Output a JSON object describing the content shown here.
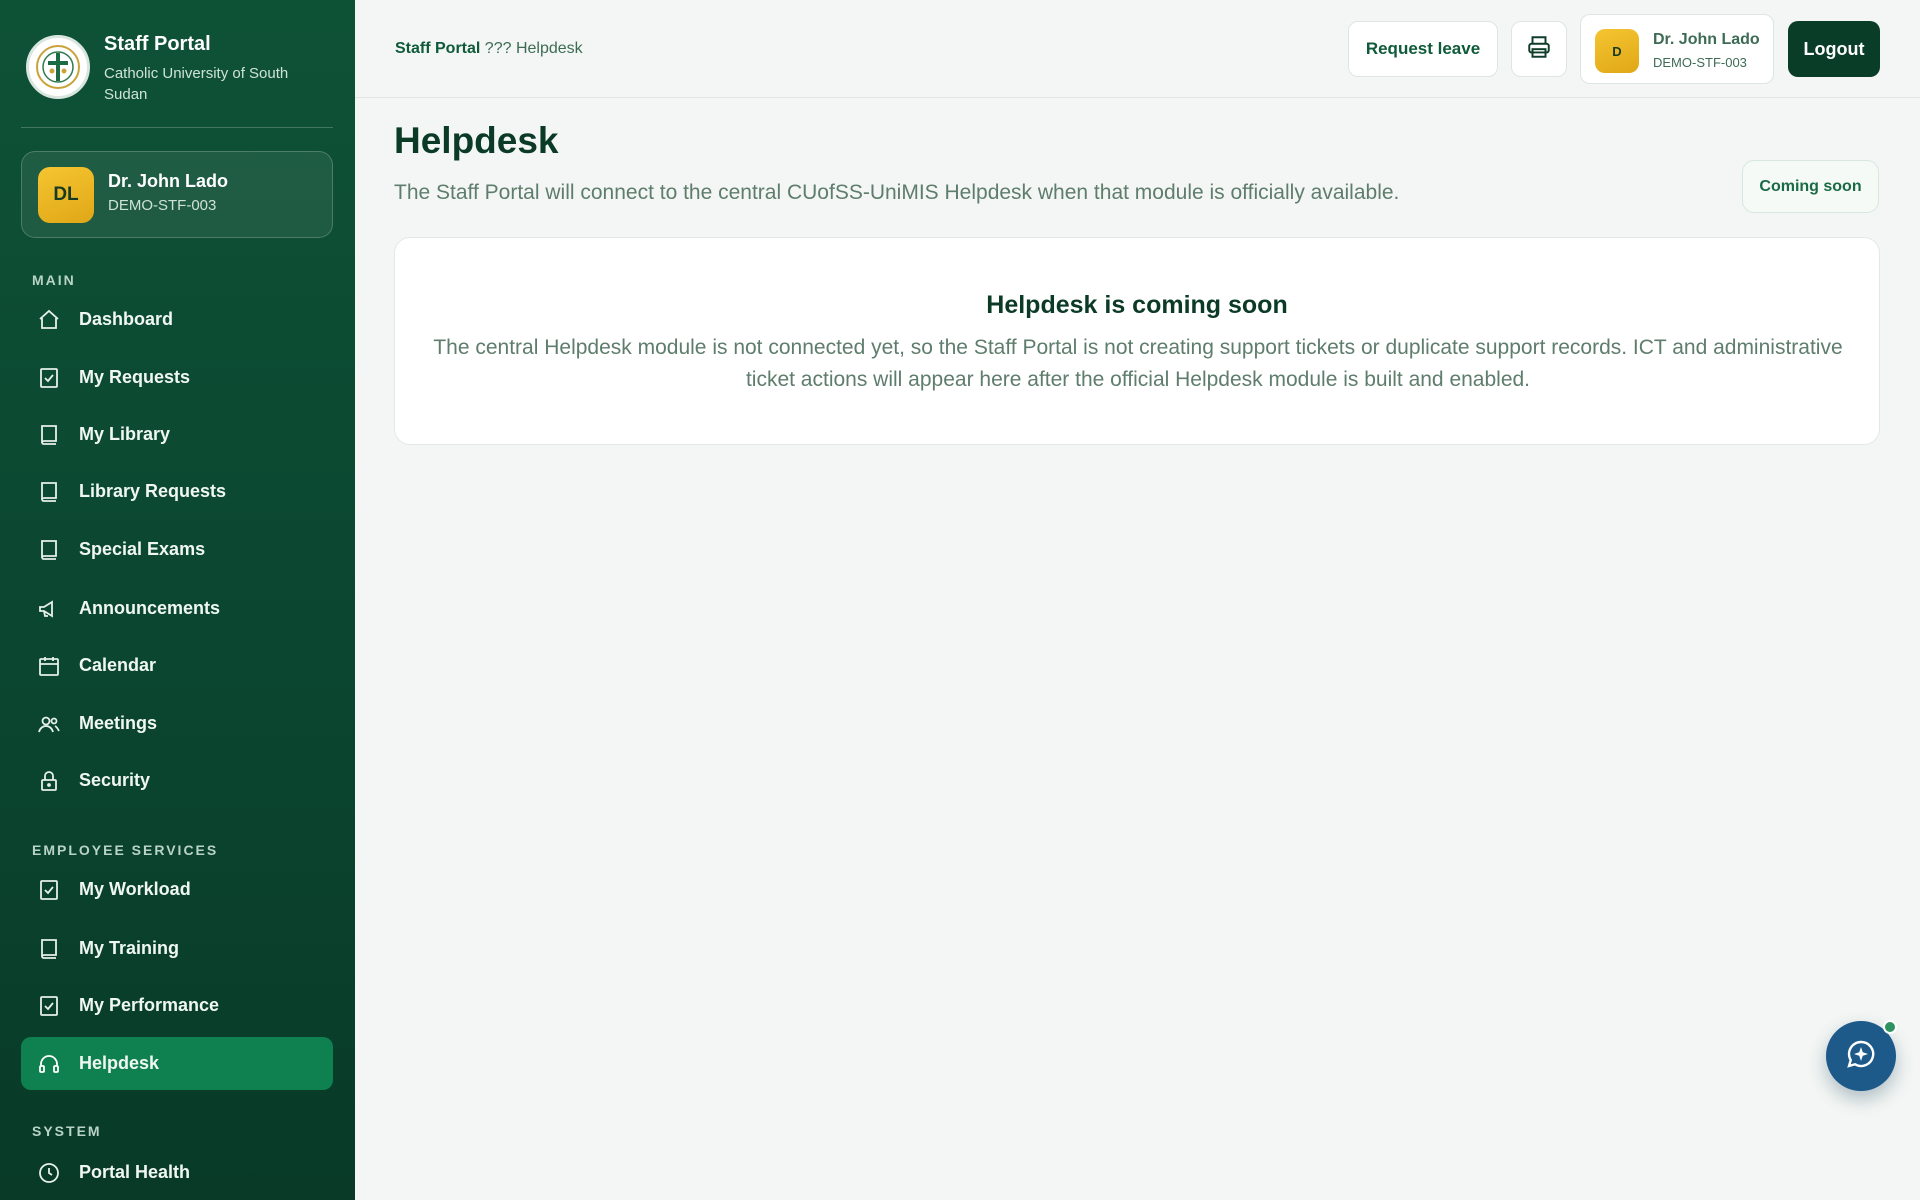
{
  "brand": {
    "title": "Staff Portal",
    "subtitle": "Catholic University of South Sudan"
  },
  "user": {
    "initials": "DL",
    "name": "Dr. John Lado",
    "id": "DEMO-STF-003",
    "top_initial": "D"
  },
  "sidebar": {
    "sections": {
      "main": "MAIN",
      "employee": "EMPLOYEE SERVICES",
      "system": "SYSTEM"
    },
    "items": [
      {
        "label": "Dashboard",
        "icon": "home-icon"
      },
      {
        "label": "My Requests",
        "icon": "checklist-icon"
      },
      {
        "label": "My Library",
        "icon": "book-icon"
      },
      {
        "label": "Library Requests",
        "icon": "book-icon"
      },
      {
        "label": "Special Exams",
        "icon": "book-icon"
      },
      {
        "label": "Announcements",
        "icon": "megaphone-icon"
      },
      {
        "label": "Calendar",
        "icon": "calendar-icon"
      },
      {
        "label": "Meetings",
        "icon": "users-icon"
      },
      {
        "label": "Security",
        "icon": "lock-icon"
      },
      {
        "label": "My Workload",
        "icon": "checklist-icon"
      },
      {
        "label": "My Training",
        "icon": "book-icon"
      },
      {
        "label": "My Performance",
        "icon": "checklist-icon"
      },
      {
        "label": "Helpdesk",
        "icon": "headset-icon",
        "active": true
      },
      {
        "label": "Portal Health",
        "icon": "clock-icon"
      }
    ]
  },
  "topbar": {
    "breadcrumb_root": "Staff Portal",
    "breadcrumb_rest": "??? Helpdesk",
    "request_leave": "Request leave",
    "logout": "Logout"
  },
  "main": {
    "title": "Helpdesk",
    "subtitle": "The Staff Portal will connect to the central CUofSS-UniMIS Helpdesk when that module is officially available.",
    "badge": "Coming soon",
    "card_title": "Helpdesk is coming soon",
    "card_body": "The central Helpdesk module is not connected yet, so the Staff Portal is not creating support tickets or duplicate support records. ICT and administrative ticket actions will appear here after the official Helpdesk module is built and enabled."
  },
  "colors": {
    "sidebar": "#0b4630",
    "accent": "#0f8150",
    "avatar": "#f0b823",
    "fab": "#1d5a8a"
  }
}
